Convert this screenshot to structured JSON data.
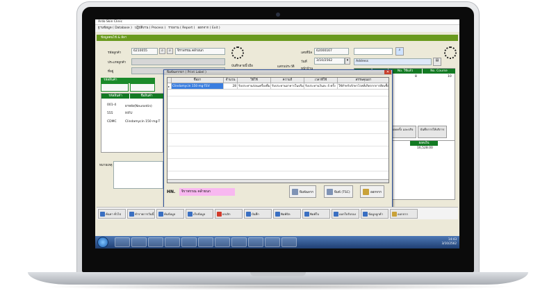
{
  "app": {
    "title": "Ardo Skin Clinic"
  },
  "menu": [
    "ฐานข้อมูล ( Database )",
    "ปฏิบัติงาน ( Process )",
    "รายงาน ( Report )",
    "ออกจาก ( Exit )"
  ],
  "section_title": "ข้อมูลคนไข้ & ลีลา",
  "left_form": {
    "customer_code_label": "รหัสลูกค้า",
    "customer_code": "6210055",
    "customer_name": "จิราพรรณ คล้ายนก",
    "customer_type_label": "ประเภทลูกค้า",
    "address_label": "ที่อยู่",
    "save_fingerprint_label": "บันทึกลายนิ้วมือ"
  },
  "mid_form": {
    "id_no_label": "เลขที่บิล",
    "id_no": "62000167",
    "date_label": "วันที่",
    "date": "3/10/2562",
    "page_label": "หน้าบ้าน",
    "scan_label": "แสกนประวัติ"
  },
  "right_form": {
    "hn_label": "HN.no",
    "address_label": "Address"
  },
  "right_table": {
    "headers": [
      "เหลือ",
      "No. ใช้แล้ว",
      "No. Course"
    ],
    "row": [
      "",
      "8",
      "10"
    ]
  },
  "products_panel": {
    "header": "รหัสสินค้า",
    "col1": "รหัสสินค้า",
    "col2": "ชื่อสินค้า"
  },
  "products": [
    {
      "code": "001-4",
      "name": "ยาหลัง(Neurontin)"
    },
    {
      "code": "555",
      "name": "HIFU"
    },
    {
      "code": "CDMC",
      "name": "Clindamycin 150 mg-T"
    }
  ],
  "remarks_label": "หมายเหตุ",
  "side_buttons": {
    "history": "ยอดครั้ง และบริจ",
    "service": "บันทึกการให้บริการ"
  },
  "totals": {
    "header": "ยอดเงิน",
    "value": "16,528.00"
  },
  "dialog": {
    "title": "พิมพ์ฉลากยา ( Print Label )",
    "headers": [
      "ชื่อยา",
      "จำนวน",
      "วิธีใช้",
      "ความถี่",
      "เวลาที่ใช้",
      "สรรพคุณยา"
    ],
    "row": [
      "Clindamycin 150 mg-TEV",
      "28",
      "รับประทานก่อนเครื่องดื่ม",
      "รับประทานอาหารในปริมาณมาก",
      "รับประทานวันละ 4 ครั้ง",
      "ใช้สำหรับรักษาโรคที่เกิดจากการติดเชื้อแบคทีเรีย"
    ],
    "hn_label": "HN.",
    "hn_value": "จิราพรรณ คล้ายนก",
    "print_label_btn": "พิมพ์ฉลาก",
    "print_tsc_btn": "พิมพ์ (TSC)",
    "exit_btn": "ออกจาก"
  },
  "toolbar": [
    "ค้นหา ทั่วไป",
    "ทำรายการวันนี้",
    "ค้นข้อมูล",
    "เก็บข้อมูล",
    "ยกเลิก",
    "บันทึก",
    "พิมพ์บิล",
    "พิมพ์ใบ",
    "ออกใบรับรอง",
    "ข้อมูลลูกค้า",
    "ออกจาก"
  ],
  "clock": {
    "time": "14:43",
    "date": "3/10/2562"
  }
}
